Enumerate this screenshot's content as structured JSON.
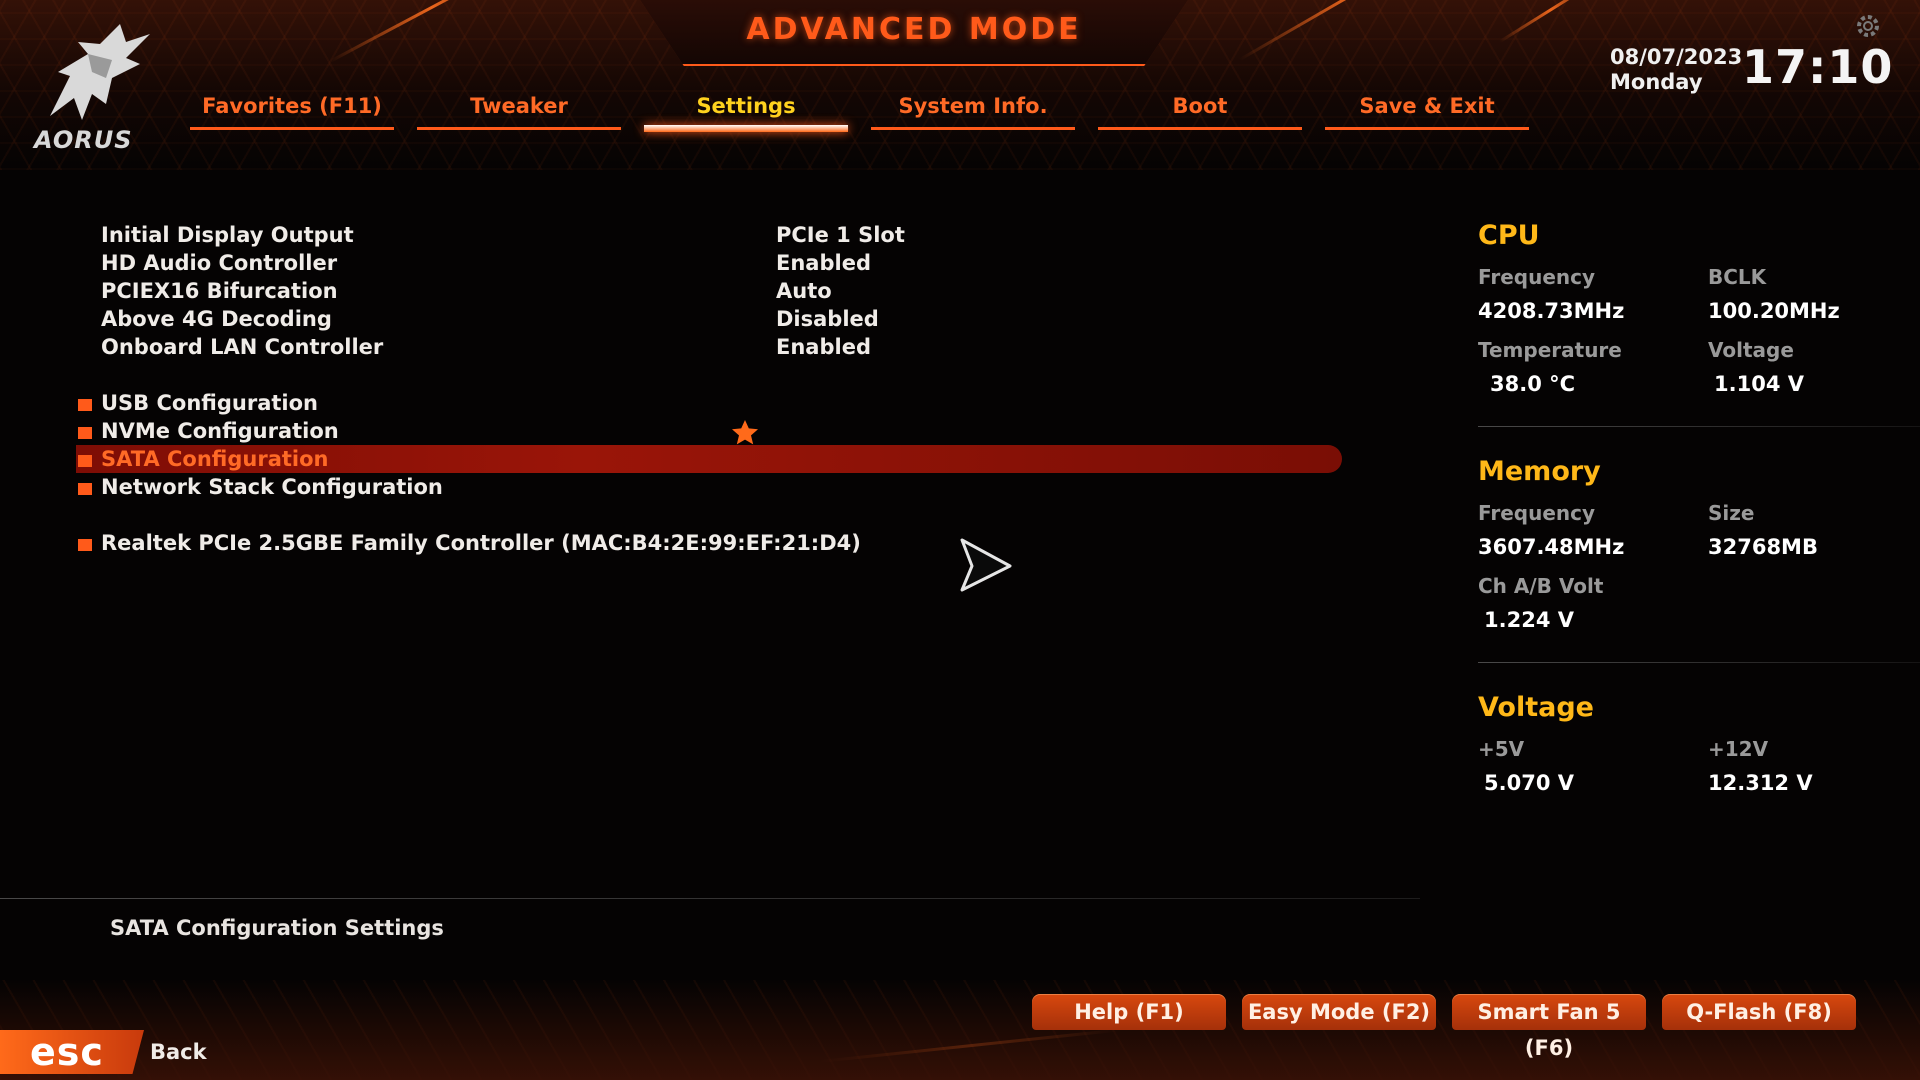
{
  "header": {
    "title": "ADVANCED MODE",
    "logo_text": "AORUS",
    "date": "08/07/2023",
    "weekday": "Monday",
    "time": "17:10"
  },
  "tabs": [
    {
      "label": "Favorites (F11)",
      "active": false
    },
    {
      "label": "Tweaker",
      "active": false
    },
    {
      "label": "Settings",
      "active": true
    },
    {
      "label": "System Info.",
      "active": false
    },
    {
      "label": "Boot",
      "active": false
    },
    {
      "label": "Save & Exit",
      "active": false
    }
  ],
  "settings": [
    {
      "name": "Initial Display Output",
      "value": "PCIe 1 Slot"
    },
    {
      "name": "HD Audio Controller",
      "value": "Enabled"
    },
    {
      "name": "PCIEX16 Bifurcation",
      "value": "Auto"
    },
    {
      "name": "Above 4G Decoding",
      "value": "Disabled"
    },
    {
      "name": "Onboard LAN Controller",
      "value": "Enabled"
    }
  ],
  "submenus": [
    {
      "name": "USB Configuration",
      "selected": false
    },
    {
      "name": "NVMe Configuration",
      "selected": false,
      "favorite": true
    },
    {
      "name": "SATA Configuration",
      "selected": true
    },
    {
      "name": "Network Stack Configuration",
      "selected": false
    },
    {
      "name": "Realtek PCIe 2.5GBE Family Controller (MAC:B4:2E:99:EF:21:D4)",
      "selected": false
    }
  ],
  "status": {
    "cpu": {
      "title": "CPU",
      "frequency_label": "Frequency",
      "frequency": "4208.73MHz",
      "bclk_label": "BCLK",
      "bclk": "100.20MHz",
      "temperature_label": "Temperature",
      "temperature": "38.0 °C",
      "voltage_label": "Voltage",
      "voltage": "1.104 V"
    },
    "memory": {
      "title": "Memory",
      "frequency_label": "Frequency",
      "frequency": "3607.48MHz",
      "size_label": "Size",
      "size": "32768MB",
      "volt_label": "Ch A/B Volt",
      "volt": "1.224 V"
    },
    "voltage": {
      "title": "Voltage",
      "v5_label": "+5V",
      "v5": "5.070 V",
      "v12_label": "+12V",
      "v12": "12.312 V"
    }
  },
  "description": "SATA Configuration Settings",
  "footer": {
    "help": "Help (F1)",
    "easy_mode": "Easy Mode (F2)",
    "smart_fan": "Smart Fan 5 (F6)",
    "qflash": "Q-Flash (F8)",
    "esc": "esc",
    "back": "Back"
  },
  "colors": {
    "accent": "#ff5a1a",
    "tab_active": "#ffd21e",
    "section_title": "#ffb818",
    "highlight_row": "#8a1106"
  },
  "icons": [
    "aorus-logo-icon",
    "gear-icon",
    "favorite-star-icon",
    "mouse-cursor-icon"
  ]
}
